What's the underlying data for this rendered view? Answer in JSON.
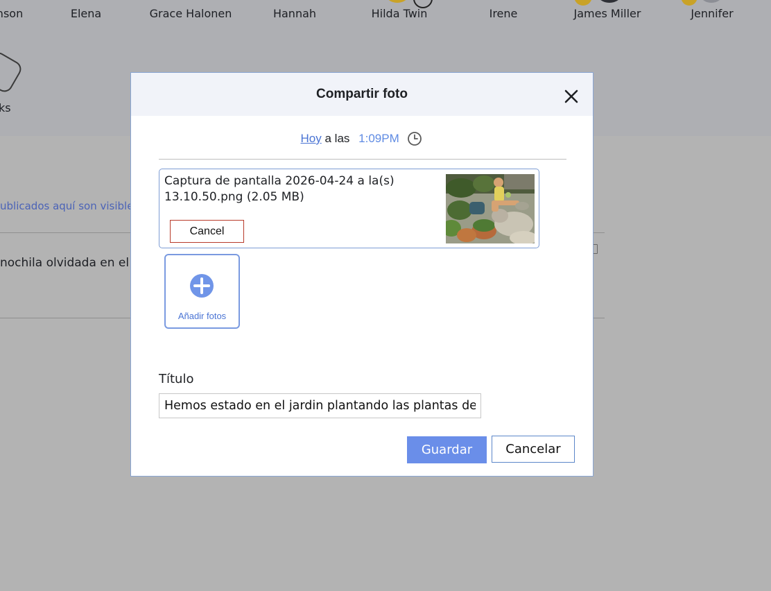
{
  "background": {
    "contacts": [
      {
        "name": "nson"
      },
      {
        "name": "Elena"
      },
      {
        "name": "Grace Halonen"
      },
      {
        "name": "Hannah"
      },
      {
        "name": "Hilda Twin"
      },
      {
        "name": "Irene"
      },
      {
        "name": "James Miller"
      },
      {
        "name": "Jennifer"
      }
    ],
    "partial_contact": "ks",
    "info_text": "ublicados aquí son visible",
    "post_text": "nochila olvidada en el p"
  },
  "modal": {
    "title": "Compartir foto",
    "close_icon": "close-icon",
    "date": {
      "day_link": "Hoy",
      "connector": "a las",
      "time": "1:09PM",
      "clock_icon": "clock-icon"
    },
    "file": {
      "name": "Captura de pantalla 2026-04-24 a la(s) 13.10.50.png (2.05 MB)",
      "cancel_label": "Cancel"
    },
    "add_photos_label": "Añadir fotos",
    "title_field": {
      "label": "Título",
      "value": "Hemos estado en el jardin plantando las plantas de"
    },
    "save_label": "Guardar",
    "cancel_label": "Cancelar",
    "colors": {
      "accent": "#6a8ee9",
      "link": "#4a74d4",
      "danger_border": "#b83a2a"
    }
  }
}
